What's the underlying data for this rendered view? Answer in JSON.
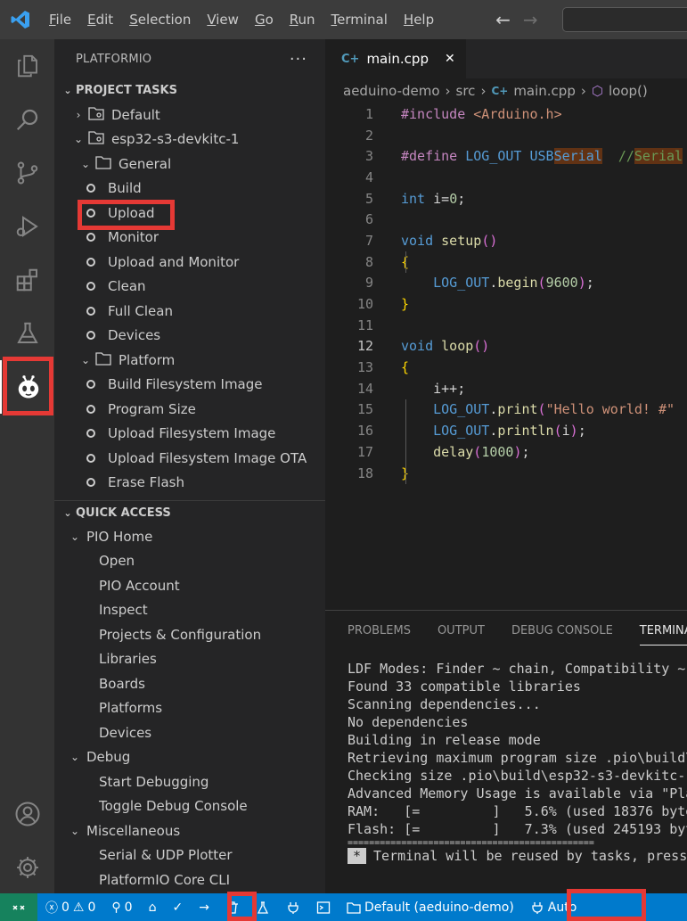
{
  "menubar": {
    "items": [
      {
        "label": "File",
        "mnemonic": "F",
        "rest": "ile"
      },
      {
        "label": "Edit",
        "mnemonic": "E",
        "rest": "dit"
      },
      {
        "label": "Selection",
        "mnemonic": "S",
        "rest": "election"
      },
      {
        "label": "View",
        "mnemonic": "V",
        "rest": "iew"
      },
      {
        "label": "Go",
        "mnemonic": "G",
        "rest": "o"
      },
      {
        "label": "Run",
        "mnemonic": "R",
        "rest": "un"
      },
      {
        "label": "Terminal",
        "mnemonic": "T",
        "rest": "erminal"
      },
      {
        "label": "Help",
        "mnemonic": "H",
        "rest": "elp"
      }
    ],
    "back_icon": "arrow-left-icon",
    "forward_icon": "arrow-right-icon"
  },
  "sidebar": {
    "title": "PLATFORMIO",
    "more": "···",
    "project_tasks": {
      "header": "PROJECT TASKS",
      "default_env": "Default",
      "env": "esp32-s3-devkitc-1",
      "general": {
        "label": "General",
        "tasks": [
          "Build",
          "Upload",
          "Monitor",
          "Upload and Monitor",
          "Clean",
          "Full Clean",
          "Devices"
        ]
      },
      "platform": {
        "label": "Platform",
        "tasks": [
          "Build Filesystem Image",
          "Program Size",
          "Upload Filesystem Image",
          "Upload Filesystem Image OTA",
          "Erase Flash"
        ]
      }
    },
    "quick_access": {
      "header": "QUICK ACCESS",
      "pio_home": {
        "label": "PIO Home",
        "items": [
          "Open",
          "PIO Account",
          "Inspect",
          "Projects & Configuration",
          "Libraries",
          "Boards",
          "Platforms",
          "Devices"
        ]
      },
      "debug": {
        "label": "Debug",
        "items": [
          "Start Debugging",
          "Toggle Debug Console"
        ]
      },
      "misc": {
        "label": "Miscellaneous",
        "items": [
          "Serial & UDP Plotter",
          "PlatformIO Core CLI"
        ]
      }
    }
  },
  "editor": {
    "tab": {
      "icon": "C+",
      "label": "main.cpp",
      "close": "✕"
    },
    "breadcrumb": [
      "aeduino-demo",
      "src",
      "main.cpp",
      "loop()"
    ],
    "current_line": 12
  },
  "panel": {
    "tabs": [
      "PROBLEMS",
      "OUTPUT",
      "DEBUG CONSOLE",
      "TERMINAL"
    ],
    "active_tab": "TERMINAL",
    "terminal_lines": [
      "LDF Modes: Finder ~ chain, Compatibility ~",
      "Found 33 compatible libraries",
      "Scanning dependencies...",
      "No dependencies",
      "Building in release mode",
      "Retrieving maximum program size .pio\\build\\",
      "Checking size .pio\\build\\esp32-s3-devkitc-1",
      "Advanced Memory Usage is available via \"Pla",
      "RAM:   [=         ]   5.6% (used 18376 byte",
      "Flash: [=         ]   7.3% (used 245193 byt",
      "=============================================="
    ],
    "reuse_marker": "*",
    "reuse_text": "Terminal will be reused by tasks, press"
  },
  "statusbar": {
    "errors": "0",
    "warnings": "0",
    "ports": "0",
    "env_label": "Default (aeduino-demo)",
    "port_label": "Auto"
  },
  "colors": {
    "statusbar": "#007acc",
    "highlight": "#e53935",
    "remote": "#16825d"
  }
}
